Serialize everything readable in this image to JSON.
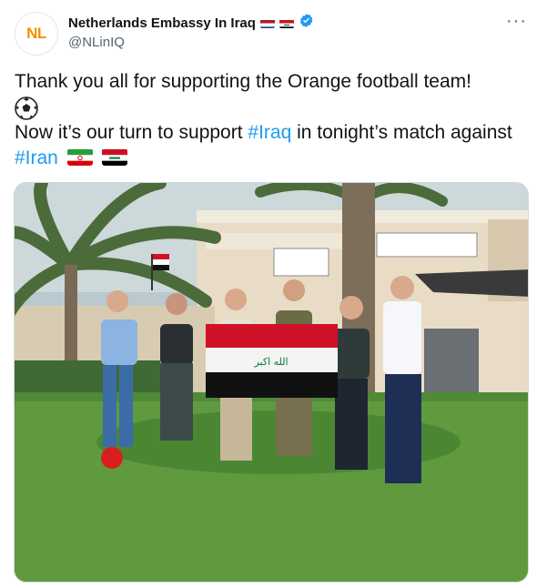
{
  "tweet": {
    "avatar_text": "NL",
    "author_name": "Netherlands Embassy In Iraq",
    "handle": "@NLinIQ",
    "more_label": "···",
    "line1": "Thank you all for supporting the Orange football team!",
    "line2_prefix": "Now it’s our turn to support ",
    "hashtag_iraq": "#Iraq",
    "line2_suffix": " in tonight’s match against ",
    "hashtag_iran": "#Iran",
    "flag_text": "الله اكبر"
  },
  "colors": {
    "accent": "#1d9bf0",
    "brand_orange": "#f29100",
    "text": "#0f1419",
    "muted": "#536471"
  },
  "icons": [
    "verified-badge-icon",
    "more-options-icon",
    "soccer-ball-icon",
    "netherlands-flag-icon",
    "iraq-flag-icon",
    "iran-flag-icon"
  ]
}
